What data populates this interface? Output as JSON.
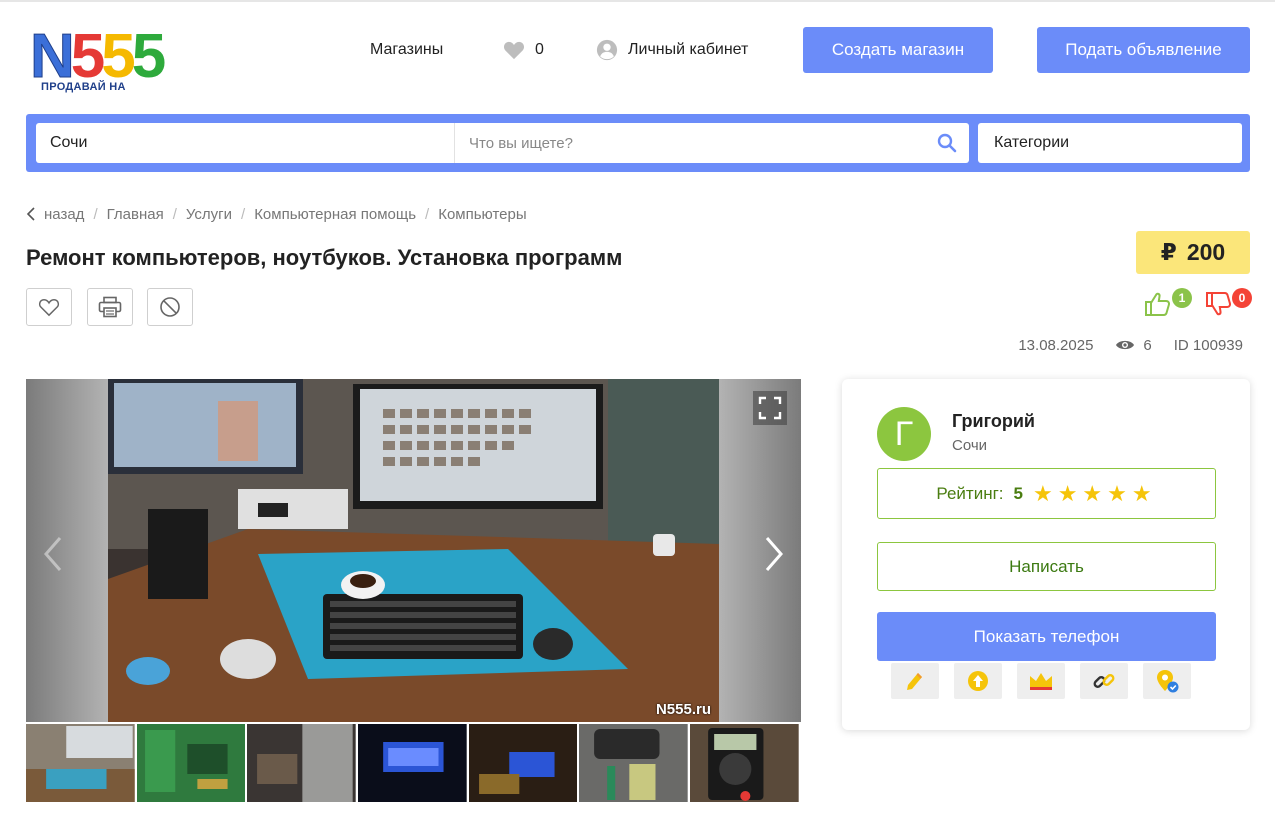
{
  "header": {
    "logo_text_n": "N",
    "logo_text_555": [
      "5",
      "5",
      "5"
    ],
    "logo_tagline": "ПРОДАВАЙ НА",
    "nav": {
      "stores": "Магазины",
      "favorites_count": "0",
      "cabinet": "Личный кабинет"
    },
    "create_store": "Создать магазин",
    "post_ad": "Подать объявление"
  },
  "search": {
    "city": "Сочи",
    "placeholder": "Что вы ищете?",
    "categories": "Категории"
  },
  "breadcrumbs": [
    "назад",
    "Главная",
    "Услуги",
    "Компьютерная помощь",
    "Компьютеры"
  ],
  "listing": {
    "title": "Ремонт компьютеров, ноутбуков. Установка программ",
    "currency": "₽",
    "price": "200",
    "likes": "1",
    "dislikes": "0",
    "date": "13.08.2025",
    "views": "6",
    "id": "ID 100939",
    "watermark": "N555.ru"
  },
  "seller": {
    "initial": "Г",
    "name": "Григорий",
    "city": "Сочи",
    "rating_label": "Рейтинг:",
    "rating_value": "5",
    "stars": "★★★★★",
    "write": "Написать",
    "show_phone": "Показать телефон"
  },
  "colors": {
    "accent_blue": "#6b8cf9",
    "price_yellow": "#fbe67a",
    "green": "#8cc63f",
    "red": "#f44336"
  },
  "icons": {
    "promo": [
      "pencil-icon",
      "arrow-up-icon",
      "crown-icon",
      "link-icon",
      "location-check-icon"
    ]
  }
}
